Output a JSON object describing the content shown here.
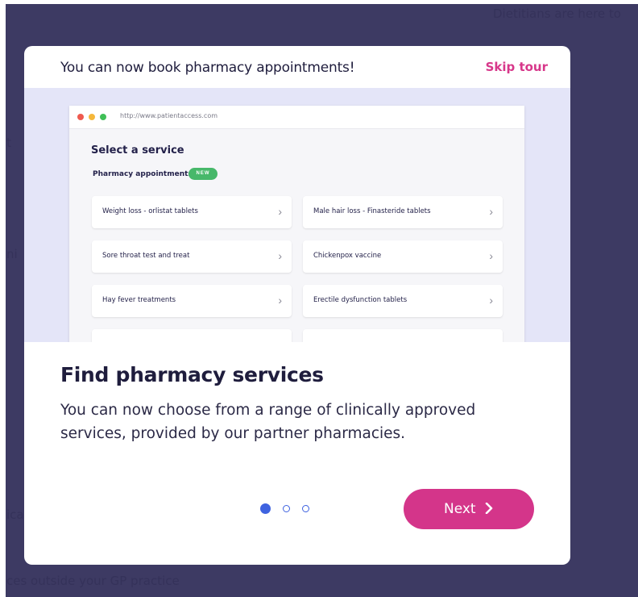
{
  "background": {
    "top_right_text": "Dietitians are here to",
    "left_fragment_1": "t",
    "left_fragment_2": "ni",
    "left_fragment_3": "ica",
    "bottom_text": "ces outside your GP practice"
  },
  "modal": {
    "header_title": "You can now book pharmacy appointments!",
    "skip_label": "Skip tour",
    "content_title": "Find pharmacy services",
    "content_body": "You can now choose from a range of clinically approved services, provided by our partner pharmacies.",
    "next_label": "Next",
    "pager": {
      "total": 3,
      "active_index": 0
    }
  },
  "illustration": {
    "url": "http://www.patientaccess.com",
    "title": "Select a service",
    "subtitle": "Pharmacy appointments",
    "badge": "NEW",
    "services": [
      "Weight loss - orlistat tablets",
      "Male hair loss - Finasteride tablets",
      "Sore throat test and treat",
      "Chickenpox vaccine",
      "Hay fever treatments",
      "Erectile dysfunction tablets"
    ]
  },
  "colors": {
    "backdrop": "#3d3a63",
    "accent": "#d4358a",
    "pager_active": "#3f63e0",
    "badge_green": "#47b86a"
  }
}
